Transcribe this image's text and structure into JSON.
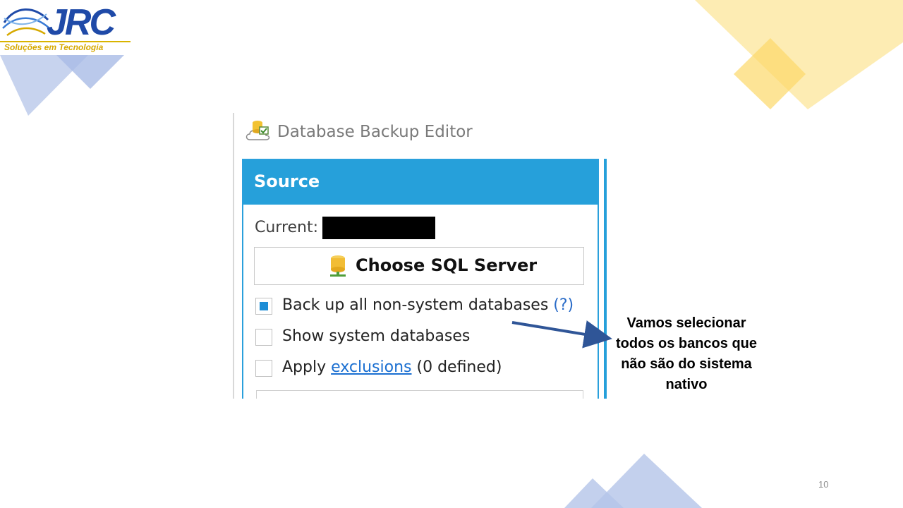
{
  "logo": {
    "brand": "JRC",
    "tagline": "Soluções em Tecnologia"
  },
  "window": {
    "title": "Database Backup Editor",
    "title_icon": "database-backup-icon"
  },
  "source": {
    "header": "Source",
    "current_label": "Current:",
    "current_value_redacted": true,
    "choose_button": {
      "label": "Choose SQL Server",
      "icon": "sql-server-icon"
    },
    "options": [
      {
        "label": "Back up all non-system databases",
        "help": "(?)",
        "checked": true
      },
      {
        "label": "Show system databases",
        "checked": false
      },
      {
        "prefix": "Apply",
        "link": "exclusions",
        "suffix": "(0 defined)",
        "checked": false
      }
    ]
  },
  "annotation": {
    "text_lines": [
      "Vamos selecionar",
      "todos os bancos que",
      "não são do sistema",
      "nativo"
    ]
  },
  "page_number": "10",
  "colors": {
    "header_blue": "#26a0da",
    "checkbox_blue": "#1e8ed6",
    "arrow_blue": "#2f5597",
    "deco_blue": "#b4c4e8",
    "deco_yellow": "#fde9a6",
    "logo_blue": "#1f4aa8",
    "logo_gold": "#d6a900"
  }
}
